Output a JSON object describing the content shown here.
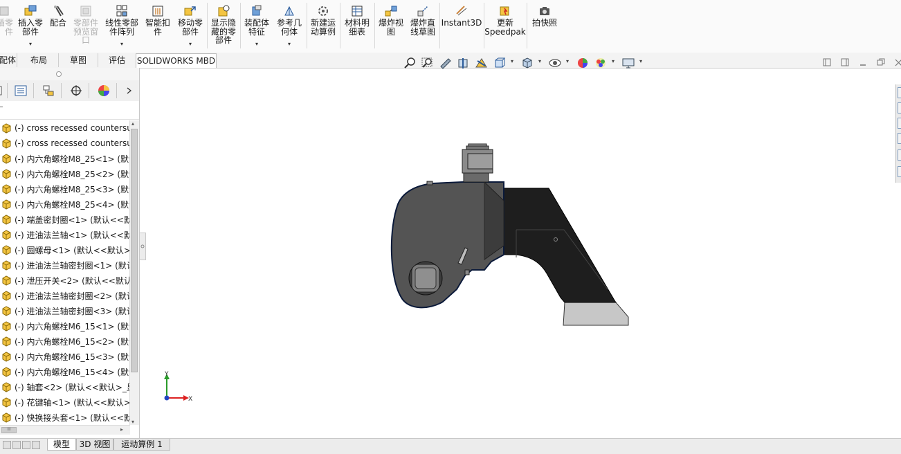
{
  "ribbon": {
    "buttons": [
      {
        "label": "插入零\n部件",
        "icon": "insert-component-icon",
        "dropdown": true
      },
      {
        "label": "配合",
        "icon": "mate-icon",
        "dropdown": false
      },
      {
        "label": "零部件\n预览窗\n口",
        "icon": "component-preview-icon",
        "disabled": true,
        "dropdown": false
      },
      {
        "label": "线性零部\n件阵列",
        "icon": "linear-pattern-icon",
        "dropdown": true
      },
      {
        "label": "智能扣\n件",
        "icon": "smart-fasteners-icon",
        "dropdown": false
      },
      {
        "label": "移动零\n部件",
        "icon": "move-component-icon",
        "dropdown": true
      },
      {
        "label": "显示隐\n藏的零\n部件",
        "icon": "show-hidden-icon",
        "dropdown": false
      },
      {
        "label": "装配体\n特征",
        "icon": "assembly-features-icon",
        "dropdown": true
      },
      {
        "label": "参考几\n何体",
        "icon": "reference-geometry-icon",
        "dropdown": true
      },
      {
        "label": "新建运\n动算例",
        "icon": "new-motion-study-icon",
        "dropdown": false
      },
      {
        "label": "材料明\n细表",
        "icon": "bom-icon",
        "dropdown": false
      },
      {
        "label": "爆炸视\n图",
        "icon": "exploded-view-icon",
        "dropdown": false
      },
      {
        "label": "爆炸直\n线草图",
        "icon": "explode-line-sketch-icon",
        "dropdown": false
      },
      {
        "label": "Instant3D",
        "icon": "instant3d-icon",
        "dropdown": false
      },
      {
        "label": "更新\nSpeedpak",
        "icon": "speedpak-icon",
        "dropdown": false
      },
      {
        "label": "拍快照",
        "icon": "snapshot-icon",
        "dropdown": false
      }
    ],
    "cut_label": "插零\n件"
  },
  "command_tabs": [
    "配体",
    "布局",
    "草图",
    "评估",
    "SOLIDWORKS MBD"
  ],
  "feature_tree": {
    "items": [
      "(-) cross recessed countersu",
      "(-) cross recessed countersu",
      "(-) 内六角螺栓M8_25<1> (默认",
      "(-) 内六角螺栓M8_25<2> (默认",
      "(-) 内六角螺栓M8_25<3> (默认",
      "(-) 内六角螺栓M8_25<4> (默认",
      "(-) 端盖密封圈<1> (默认<<默",
      "(-) 进油法兰轴<1> (默认<<默",
      "(-) 圆螺母<1> (默认<<默认>_",
      "(-) 进油法兰轴密封圈<1> (默认",
      "(-) 泄压开关<2> (默认<<默认",
      "(-) 进油法兰轴密封圈<2> (默认",
      "(-) 进油法兰轴密封圈<3> (默认",
      "(-) 内六角螺栓M6_15<1> (默认",
      "(-) 内六角螺栓M6_15<2> (默认",
      "(-) 内六角螺栓M6_15<3> (默认",
      "(-) 内六角螺栓M6_15<4> (默认",
      "(-) 轴套<2> (默认<<默认>_显",
      "(-) 花键轴<1> (默认<<默认>_",
      "(-) 快换接头套<1> (默认<<默"
    ]
  },
  "bottom_tabs": [
    "模型",
    "3D 视图",
    "运动算例 1"
  ],
  "triad": {
    "y": "Y",
    "x": "X"
  },
  "colors": {
    "accent": "#1f5fae",
    "part": "#f4c542",
    "tool_dark": "#2a2a2a",
    "tool_grey": "#555555"
  }
}
